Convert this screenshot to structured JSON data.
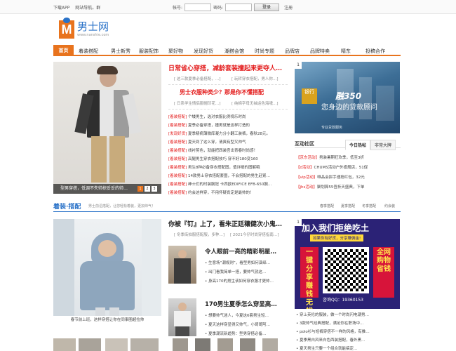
{
  "topbar": {
    "links": [
      "下载APP",
      "网站导航。群"
    ],
    "account_label": "帐号:",
    "password_label": "密码:",
    "login_button": "登录",
    "register": "注册"
  },
  "logo": {
    "mark": "M",
    "name": "男士网",
    "url": "www.nanshie.com"
  },
  "nav": {
    "home": "首页",
    "items": [
      "着装搭配",
      "男士新秀",
      "服装配饰",
      "聚好物",
      "发现好货",
      "潮搭会馆",
      "时尚专题",
      "品牌店",
      "品牌特卖",
      "精东",
      "投稿合作"
    ]
  },
  "slideshow": {
    "caption": "型男穿搭，低调不失帅掠妥妥的帅…",
    "pages": [
      "1",
      "2",
      "3"
    ]
  },
  "headline1": {
    "title": "日常省心穿搭，减龄套装撞起来更夺人…",
    "subs": [
      "[ 这三款夏季必备搭配，…]",
      "[ 玩转穿衣搭配，男人你…]"
    ]
  },
  "headline2": {
    "title": "男士衣服种类少？那是你不懂搭配",
    "subs": [
      "[ 日系学生情侣服帽印花…]",
      "[ 纯棉字母无袖运色海魂…]"
    ]
  },
  "news": [
    {
      "tag": "[着装搭配]",
      "text": "个矮男生，选对衣服比例视乐时尚"
    },
    {
      "tag": "[着装搭配]",
      "text": "夏季必备穿搭，撞男就是这样打造的"
    },
    {
      "tag": "[发现好货]",
      "text": "夏季精病薄微库凝力分小翻工装裤，春秋28元。"
    },
    {
      "tag": "[着装搭配]",
      "text": "夏天到了这么穿，清爽有型又帅气"
    },
    {
      "tag": "[着装搭配]",
      "text": "线衬剪色，就能把西装宫出青春时尚感！"
    },
    {
      "tag": "[着装搭配]",
      "text": "高腿男生穿衣搭配技巧 穿不好180变160"
    },
    {
      "tag": "[着装搭配]",
      "text": "男生8种必备穿衣搭配图，值详细的图解哦"
    },
    {
      "tag": "[着装搭配]",
      "text": "14款男士穿衣搭配套图，不会搭配的男生赶紧…"
    },
    {
      "tag": "[着装搭配]",
      "text": "绅士们的时装腕冠 卡西欧EDIFICE EFB-650腕…"
    },
    {
      "tag": "[着装搭配]",
      "text": "约会这样穿，不用怀疑肯定是最帅的！"
    }
  ],
  "ad1": {
    "num": "1",
    "bank": "银行",
    "code": "融350",
    "slogan": "您身边的贷款顾问",
    "sub": "专业贷款服务"
  },
  "community": {
    "title": "互动社区",
    "tabs": [
      "今日热帖",
      "非常大牌"
    ],
    "rows": [
      {
        "tag": "【京东活动】",
        "text": "男装暑期狂欢季，低至3折"
      },
      {
        "tag": "【d活动】",
        "text": "CHUMS活动户外旗舰店，51促"
      },
      {
        "tag": "【vip活动】",
        "text": "唯品会拼手速抢红包，32元"
      },
      {
        "tag": "【jhs活动】",
        "text": "聚划算55吾折天盛典，下单"
      }
    ]
  },
  "section2": {
    "title": "着装·搭配",
    "desc": "男士前沿搭配，让您轻松着装，更加帅气！",
    "tags": [
      "春季搭配",
      "夏季搭配",
      "冬季搭配",
      "约会装"
    ]
  },
  "big_photo": {
    "caption": "春节前上班，这样穿搭让你在同事圈超拉帅"
  },
  "article1": {
    "title": "你被『钉』上了，看朱正廷穰健次小鬼…",
    "subs": [
      "[ 冬季街拍服搭配服，多种…]",
      "[ 2021今仔时尚穿搭指南…]"
    ]
  },
  "feature1": {
    "title": "令人眼前一亮的精彩明星…",
    "bullets": [
      "生意场“潮规则”，看型男如何演绎…",
      "出门看我简单一搭，要帅气就这…",
      "身高170的男生该如何穿衣服才更帅…"
    ]
  },
  "feature2": {
    "title": "170男生夏季怎么穿显高…",
    "bullets": [
      "想要帅气迷人，今夏这6套男生短…",
      "夏天这样穿显得又帅气，小哥哥阿…",
      "夏季潮流新趋势：型男穿搭必备…"
    ]
  },
  "ad2": {
    "num": "1",
    "title": "加入我们拒绝吃土",
    "subtitle": "如果你有好货，分享赚佣金!",
    "left": "一键分享赚钱无忧",
    "right": "全网购物省钱",
    "footer": "咨询QQ：19360153"
  },
  "right_list": [
    "穿上英伦的服装，做一个时尚闪电潮男…",
    "3款帅气经典搭配，满足你在职场中…",
    "polo衫与短裤穿搭不一样的风格，有推…",
    "夏季黑白风来白色西装搭配，春外黑…",
    "夏天男生只要一个组合就能搞定…"
  ],
  "colors": {
    "accent": "#e8731d",
    "blue": "#2a72c8",
    "red": "#e31b1b"
  }
}
